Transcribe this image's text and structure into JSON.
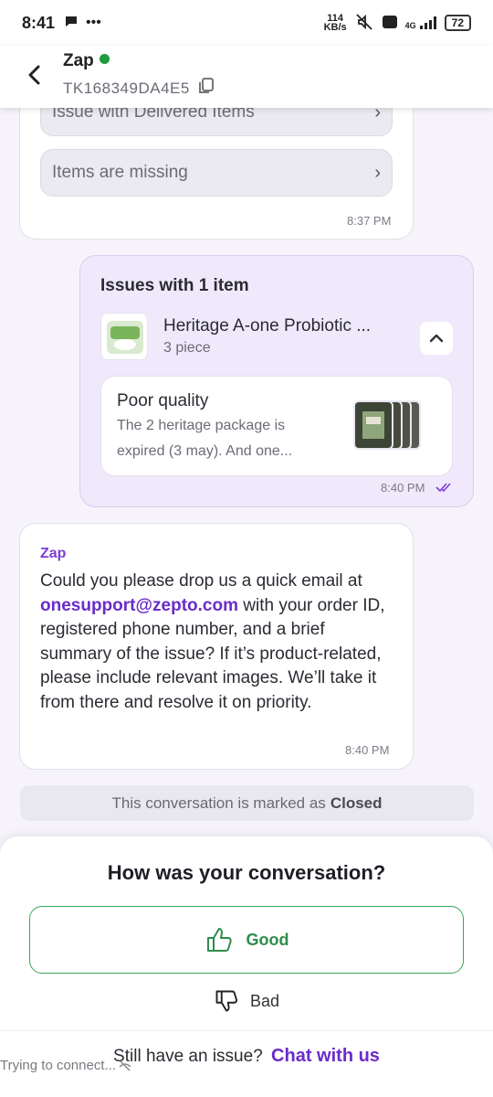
{
  "status_bar": {
    "time": "8:41",
    "net_speed_value": "114",
    "net_speed_unit": "KB/s",
    "battery": "72",
    "signal_label": "4G"
  },
  "header": {
    "agent_name": "Zap",
    "ticket_id": "TK168349DA4E5"
  },
  "options": [
    {
      "label": "Issue with Delivered Items"
    },
    {
      "label": "Items are missing"
    }
  ],
  "options_time": "8:37 PM",
  "issue_message": {
    "title": "Issues with 1 item",
    "product_name": "Heritage A-one Probiotic ...",
    "product_qty": "3 piece",
    "issue_label": "Poor quality",
    "issue_desc": "The 2 heritage package is expired (3 may). And one...",
    "time": "8:40 PM"
  },
  "zap_message": {
    "sender": "Zap",
    "text_before": "Could you please drop us a quick email at ",
    "email": "onesupport@zepto.com",
    "text_after": " with your order ID, registered phone number, and a brief summary of the issue? If it’s product-related, please include relevant images. We’ll take it from there and resolve it on priority.",
    "time": "8:40 PM"
  },
  "closed_banner": {
    "prefix": "This conversation is marked as",
    "status": "Closed"
  },
  "feedback": {
    "title": "How was your conversation?",
    "good_label": "Good",
    "bad_label": "Bad",
    "accent_good": "#2d8c4a"
  },
  "footer": {
    "still_text": "Still have an issue?",
    "chat_link": "Chat with us",
    "connecting": "Trying to connect..."
  },
  "colors": {
    "brand_purple": "#6a2cc9",
    "online_green": "#1f9c3c"
  }
}
